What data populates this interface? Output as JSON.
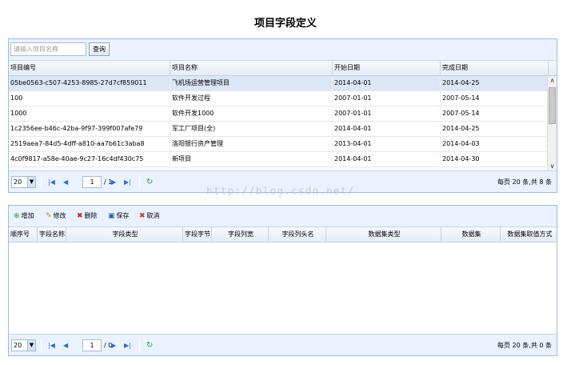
{
  "page": {
    "title": "项目字段定义"
  },
  "project_grid": {
    "search": {
      "placeholder": "请输入项目名称",
      "button": "查询"
    },
    "columns": [
      "项目编号",
      "项目名称",
      "开始日期",
      "完成日期"
    ],
    "rows": [
      [
        "05be0563-c507-4253-8985-27d7cf859011",
        "飞机场运营管理项目",
        "2014-04-01",
        "2014-04-25"
      ],
      [
        "100",
        "软件开发过程",
        "2007-01-01",
        "2007-05-14"
      ],
      [
        "1000",
        "软件开发1000",
        "2007-01-01",
        "2007-05-14"
      ],
      [
        "1c2356ee-b46c-42ba-9f97-399f007afe79",
        "军工厂项目(全)",
        "2014-04-01",
        "2014-04-25"
      ],
      [
        "2519aea7-84d5-4dff-a810-aa7b61c3aba8",
        "洛阳银行资产管理",
        "2013-04-01",
        "2014-04-03"
      ],
      [
        "4c0f9817-a58e-40ae-9c27-16c4df430c75",
        "新项目",
        "2014-04-01",
        "2014-04-30"
      ]
    ],
    "pager": {
      "page_size": "20",
      "page": "1",
      "total_pages": "/ 1",
      "info": "每页 20 条,共 8 条"
    }
  },
  "field_grid": {
    "toolbar": {
      "add": "增加",
      "edit": "修改",
      "delete": "删除",
      "save": "保存",
      "cancel": "取消"
    },
    "columns": [
      "顺序号",
      "字段名称",
      "字段类型",
      "字段字节",
      "字段列宽",
      "字段列头名",
      "数据集类型",
      "数据集",
      "数据集取值方式"
    ],
    "pager": {
      "page_size": "20",
      "page": "1",
      "total_pages": "/ 0",
      "info": "每页 20 条,共 0 条"
    }
  },
  "watermark": "http://blog.csdn.net/"
}
